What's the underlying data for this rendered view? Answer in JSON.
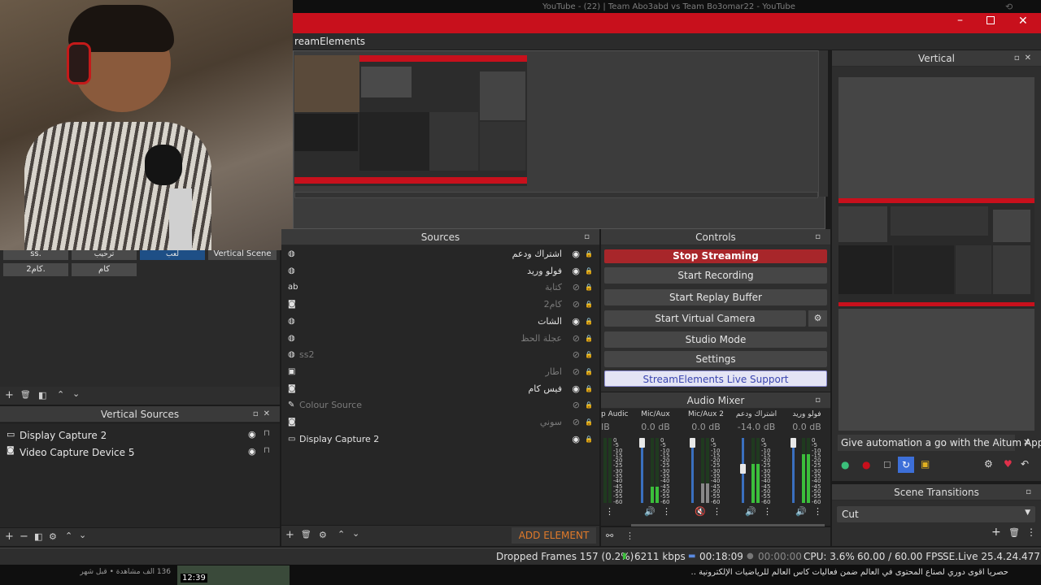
{
  "browser_bar": {
    "title": "YouTube - (22) | Team Abo3abd vs Team Bo3omar22 - YouTube"
  },
  "window": {
    "title_partial": "reamElements",
    "accent": "#c8101c"
  },
  "preview_panel": {},
  "vertical_panel": {
    "title": "Vertical"
  },
  "sources": {
    "title": "Sources",
    "items": [
      {
        "icon": "browser-icon",
        "label": "اشتراك ودعم",
        "visible": true,
        "dim": false
      },
      {
        "icon": "browser-icon",
        "label": "فولو وريد",
        "visible": true,
        "dim": false
      },
      {
        "icon": "text-icon",
        "label": "كتابة",
        "visible": false,
        "dim": true
      },
      {
        "icon": "camera-icon",
        "label": "كام2",
        "visible": false,
        "dim": true
      },
      {
        "icon": "browser-icon",
        "label": "الشات",
        "visible": true,
        "dim": false
      },
      {
        "icon": "browser-icon",
        "label": "عجلة الحظ",
        "visible": false,
        "dim": true
      },
      {
        "icon": "browser-icon",
        "label": "ss2",
        "visible": false,
        "dim": true,
        "ltr": true
      },
      {
        "icon": "image-icon",
        "label": "اطار",
        "visible": false,
        "dim": true
      },
      {
        "icon": "camera-icon",
        "label": "فيس كام",
        "visible": true,
        "dim": false
      },
      {
        "icon": "brush-icon",
        "label": "Colour Source",
        "visible": false,
        "dim": true,
        "ltr": true
      },
      {
        "icon": "camera-icon",
        "label": "سوني",
        "visible": false,
        "dim": true
      },
      {
        "icon": "monitor-icon",
        "label": "Display Capture 2",
        "visible": true,
        "dim": false,
        "ltr": true
      }
    ],
    "add_element": "ADD ELEMENT"
  },
  "scenes": {
    "items": [
      "ss.",
      "ترحيب",
      "لعب",
      "Vertical Scene",
      "كام2.",
      "كام"
    ]
  },
  "vertical_sources": {
    "title": "Vertical Sources",
    "items": [
      {
        "icon": "monitor-icon",
        "label": "Display Capture 2"
      },
      {
        "icon": "camera-icon",
        "label": "Video Capture Device 5"
      }
    ]
  },
  "controls": {
    "title": "Controls",
    "stop_streaming": "Stop Streaming",
    "start_recording": "Start Recording",
    "start_replay_buffer": "Start Replay Buffer",
    "start_virtual_camera": "Start Virtual Camera",
    "studio_mode": "Studio Mode",
    "settings": "Settings",
    "live_support": "StreamElements Live Support"
  },
  "audio_mixer": {
    "title": "Audio Mixer",
    "channels": [
      {
        "name": "Desktop Audio",
        "name_visible": "p Audic",
        "db_visible": "IB",
        "level": 0.0,
        "fader": 1.0,
        "muted": false
      },
      {
        "name": "Mic/Aux",
        "db": "0.0 dB",
        "level": 0.25,
        "fader": 1.0,
        "muted": false
      },
      {
        "name": "Mic/Aux 2",
        "db": "0.0 dB",
        "level": 0.3,
        "fader": 1.0,
        "muted": true
      },
      {
        "name": "اشتراك ودعم",
        "db": "-14.0 dB",
        "level": 0.6,
        "fader": 0.55,
        "muted": false
      },
      {
        "name": "فولو وريد",
        "db": "0.0 dB",
        "level": 0.75,
        "fader": 1.0,
        "muted": false
      }
    ]
  },
  "aitum": {
    "banner": "Give automation a go with the Aitum App"
  },
  "scene_transitions": {
    "title": "Scene Transitions",
    "selected": "Cut"
  },
  "status_bar": {
    "dropped_frames": "Dropped Frames 157 (0.2%)",
    "bitrate": "6211 kbps",
    "stream_time": "00:18:09",
    "rec_time": "00:00:00",
    "cpu": "CPU: 3.6%",
    "fps": "60.00 / 60.00 FPS",
    "version": "SE.Live 25.4.24.477"
  },
  "youtube_below": {
    "views": "136 الف مشاهدة • قبل شهر واحد",
    "duration": "12:39",
    "description": "حصرياً اقوى دوري لصناع المحتوى في العالم ضمن فعاليات كاس العالم للرياضيات الإلكترونية ...المزيد"
  }
}
